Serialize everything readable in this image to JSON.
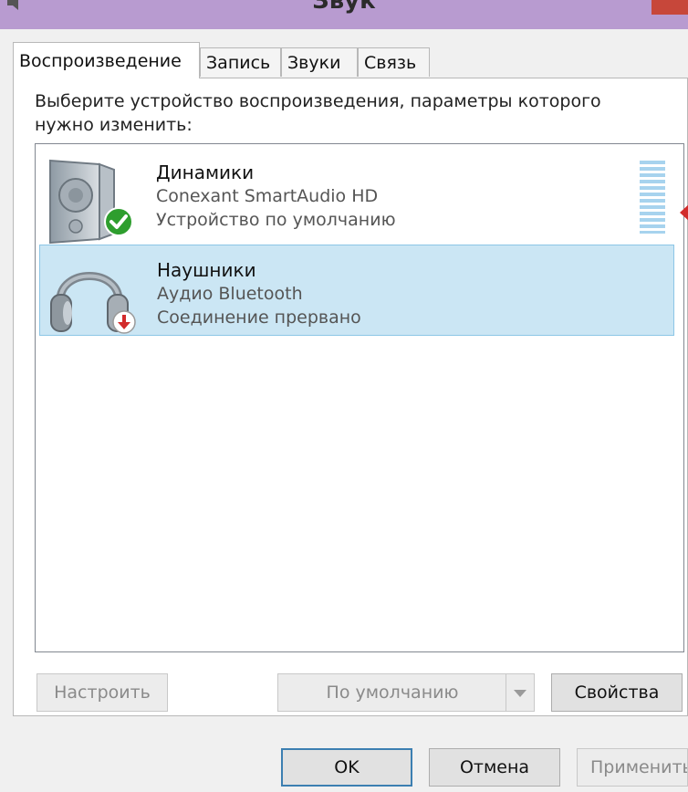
{
  "window": {
    "title": "Звук"
  },
  "tabs": [
    {
      "label": "Воспроизведение",
      "active": true
    },
    {
      "label": "Запись",
      "active": false
    },
    {
      "label": "Звуки",
      "active": false
    },
    {
      "label": "Связь",
      "active": false
    }
  ],
  "instruction": "Выберите устройство воспроизведения, параметры которого нужно изменить:",
  "devices": [
    {
      "name": "Динамики",
      "driver": "Conexant SmartAudio HD",
      "status": "Устройство по умолчанию",
      "icon": "speaker-icon",
      "badge": "default-check-icon",
      "selected": false
    },
    {
      "name": "Наушники",
      "driver": "Аудио Bluetooth",
      "status": "Соединение прервано",
      "icon": "headphones-icon",
      "badge": "disconnected-arrow-icon",
      "selected": true
    }
  ],
  "buttons": {
    "configure": "Настроить",
    "set_default": "По умолчанию",
    "properties": "Свойства",
    "ok": "OK",
    "cancel": "Отмена",
    "apply": "Применить"
  },
  "colors": {
    "titlebar": "#b89bd0",
    "selection": "#cbe6f4",
    "selection_border": "#8cc6e6",
    "check_green": "#2e9e2e",
    "disconnect_red": "#d22b2b"
  }
}
